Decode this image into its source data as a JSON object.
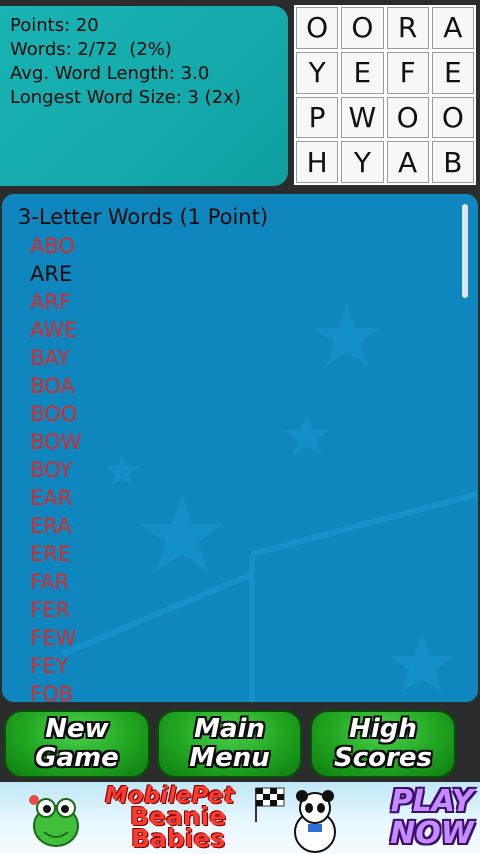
{
  "stats": {
    "points": "Points: 20",
    "words": "Words: 2/72  (2%)",
    "avg_length": "Avg. Word Length: 3.0",
    "longest": "Longest Word Size: 3 (2x)"
  },
  "board": {
    "tiles": [
      "O",
      "O",
      "R",
      "A",
      "Y",
      "E",
      "F",
      "E",
      "P",
      "W",
      "O",
      "O",
      "H",
      "Y",
      "A",
      "B"
    ]
  },
  "word_list": {
    "heading": "3-Letter Words (1 Point)",
    "items": [
      {
        "word": "ABO",
        "found": false
      },
      {
        "word": "ARE",
        "found": true
      },
      {
        "word": "ARF",
        "found": false
      },
      {
        "word": "AWE",
        "found": false
      },
      {
        "word": "BAY",
        "found": false
      },
      {
        "word": "BOA",
        "found": false
      },
      {
        "word": "BOO",
        "found": false
      },
      {
        "word": "BOW",
        "found": false
      },
      {
        "word": "BOY",
        "found": false
      },
      {
        "word": "EAR",
        "found": false
      },
      {
        "word": "ERA",
        "found": false
      },
      {
        "word": "ERE",
        "found": false
      },
      {
        "word": "FAR",
        "found": false
      },
      {
        "word": "FER",
        "found": false
      },
      {
        "word": "FEW",
        "found": false
      },
      {
        "word": "FEY",
        "found": false
      },
      {
        "word": "FOB",
        "found": false
      }
    ]
  },
  "buttons": {
    "new_game": "New\nGame",
    "main_menu": "Main\nMenu",
    "high_scores": "High\nScores"
  },
  "ad": {
    "brand": "MobilePet",
    "product": "Beanie\nBabies",
    "cta": "PLAY\nNOW"
  },
  "colors": {
    "stats_bg": "#14a9ab",
    "words_bg": "#1086be",
    "missing_word": "#d32b2b",
    "found_word": "#0c0c0c",
    "button_green": "#21a521"
  }
}
